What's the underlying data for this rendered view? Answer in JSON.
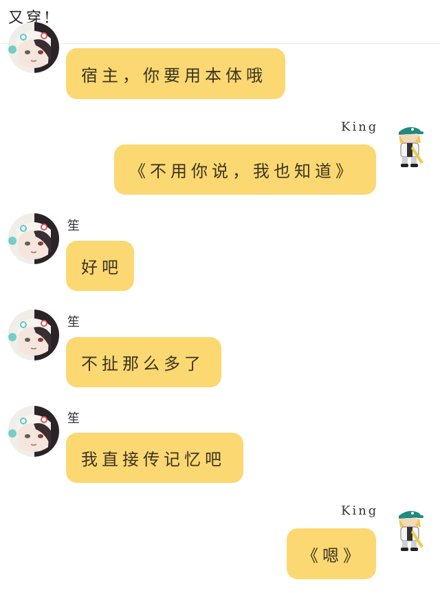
{
  "header": {
    "title": "又穿!"
  },
  "users": {
    "left": {
      "name": "笙"
    },
    "right": {
      "name": "King"
    }
  },
  "messages": [
    {
      "side": "left",
      "show_name": false,
      "text": "宿主，你要用本体哦"
    },
    {
      "side": "right",
      "show_name": true,
      "text": "《不用你说，我也知道》"
    },
    {
      "side": "left",
      "show_name": true,
      "text": "好吧"
    },
    {
      "side": "left",
      "show_name": true,
      "text": "不扯那么多了"
    },
    {
      "side": "left",
      "show_name": true,
      "text": "我直接传记忆吧"
    },
    {
      "side": "right",
      "show_name": true,
      "text": "《嗯》"
    }
  ]
}
